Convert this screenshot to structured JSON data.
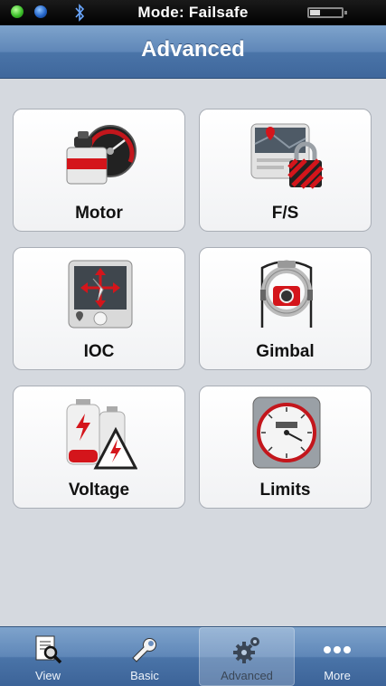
{
  "status_bar": {
    "mode_text": "Mode: Failsafe",
    "battery_level": 0.35
  },
  "nav": {
    "title": "Advanced"
  },
  "tiles": [
    {
      "label": "Motor",
      "icon": "motor-speedometer-icon"
    },
    {
      "label": "F/S",
      "icon": "map-padlock-icon"
    },
    {
      "label": "IOC",
      "icon": "compass-arrows-icon"
    },
    {
      "label": "Gimbal",
      "icon": "gimbal-camera-icon"
    },
    {
      "label": "Voltage",
      "icon": "battery-warning-icon"
    },
    {
      "label": "Limits",
      "icon": "altimeter-gauge-icon"
    }
  ],
  "tabs": [
    {
      "label": "View",
      "icon": "document-magnifier-icon"
    },
    {
      "label": "Basic",
      "icon": "wrench-icon"
    },
    {
      "label": "Advanced",
      "icon": "gears-icon",
      "active": true
    },
    {
      "label": "More",
      "icon": "more-dots-icon"
    }
  ],
  "colors": {
    "nav_blue": "#5f87b8",
    "background": "#d5d9df",
    "accent_red": "#d4151b"
  }
}
